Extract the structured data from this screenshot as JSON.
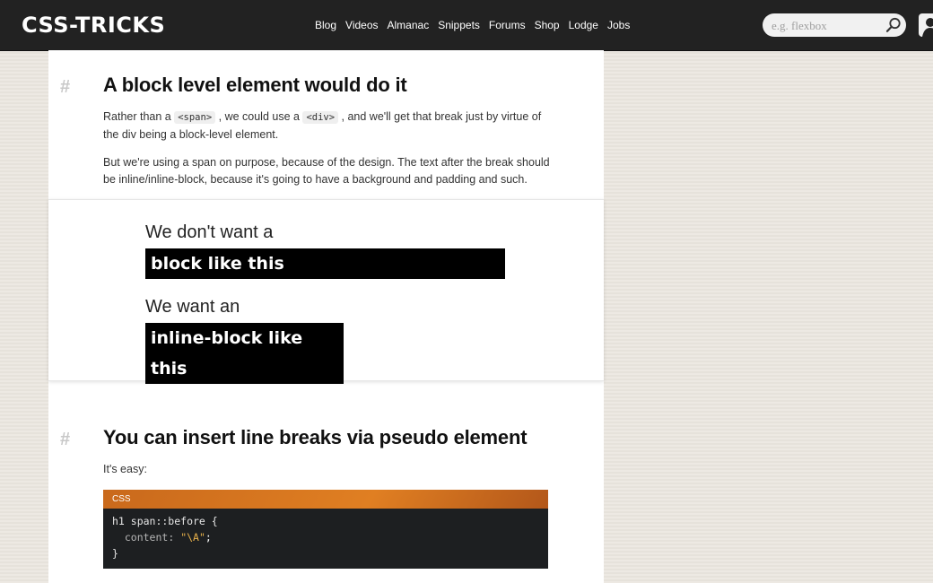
{
  "header": {
    "logo": "CSS-TRICKS",
    "nav": [
      "Blog",
      "Videos",
      "Almanac",
      "Snippets",
      "Forums",
      "Shop",
      "Lodge",
      "Jobs"
    ],
    "search_placeholder": "e.g. flexbox"
  },
  "section1": {
    "hash": "#",
    "heading": "A block level element would do it",
    "p1": {
      "a": "Rather than a ",
      "code1": "<span>",
      "b": " , we could use a ",
      "code2": "<div>",
      "c": " , and we'll get that break just by virtue of the div being a block-level element."
    },
    "p2": "But we're using a span on purpose, because of the design. The text after the break should be inline/inline-block, because it's going to have a background and padding and such."
  },
  "demo": {
    "line1": "We don't want a",
    "block1": "block like this",
    "line2": "We want an",
    "block2": "inline-block like this"
  },
  "section2": {
    "hash": "#",
    "heading": "You can insert line breaks via pseudo element",
    "p1": "It's easy:",
    "code_label": "CSS",
    "code": {
      "line1_selector": "h1 span::before {",
      "line2_prop": "content:",
      "line2_value": "\"\\A\"",
      "line2_end": ";",
      "line3": "}"
    }
  },
  "colors": {
    "topbar": "#222222",
    "code_header": "#e07f22",
    "code_bg": "#1d1f21",
    "string": "#e9b24b"
  },
  "icons": [
    "search-icon",
    "user-icon"
  ]
}
